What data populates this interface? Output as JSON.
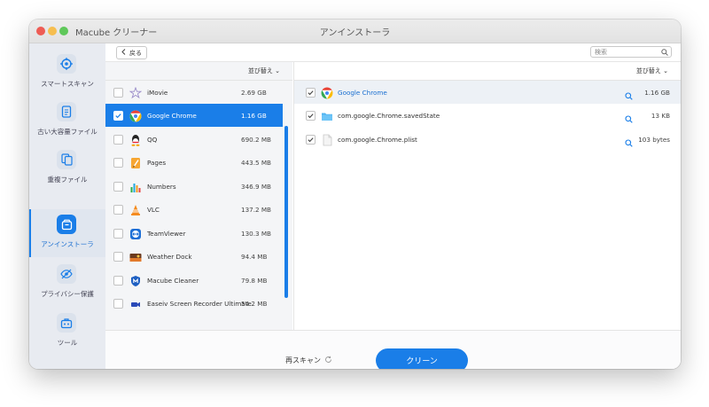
{
  "window": {
    "app_name": "Macube クリーナー",
    "title": "アンインストーラ"
  },
  "sidebar": {
    "items": [
      {
        "label": "スマートスキャン",
        "icon": "target-icon"
      },
      {
        "label": "古い大容量ファイル",
        "icon": "document-icon"
      },
      {
        "label": "重複ファイル",
        "icon": "duplicate-icon"
      },
      {
        "label": "アンインストーラ",
        "icon": "package-icon",
        "active": true
      },
      {
        "label": "プライバシー保護",
        "icon": "eye-off-icon"
      },
      {
        "label": "ツール",
        "icon": "toolbox-icon"
      }
    ]
  },
  "toolbar": {
    "back_label": "戻る",
    "search_placeholder": "検索"
  },
  "left_pane": {
    "sort_label": "並び替え",
    "apps": [
      {
        "name": "iMovie",
        "size": "2.69 GB"
      },
      {
        "name": "Google Chrome",
        "size": "1.16 GB",
        "selected": true
      },
      {
        "name": "QQ",
        "size": "690.2 MB"
      },
      {
        "name": "Pages",
        "size": "443.5 MB"
      },
      {
        "name": "Numbers",
        "size": "346.9 MB"
      },
      {
        "name": "VLC",
        "size": "137.2 MB"
      },
      {
        "name": "TeamViewer",
        "size": "130.3 MB"
      },
      {
        "name": "Weather Dock",
        "size": "94.4 MB"
      },
      {
        "name": "Macube Cleaner",
        "size": "79.8 MB"
      },
      {
        "name": "Easeiv Screen Recorder Ultimate",
        "size": "54.2 MB"
      }
    ]
  },
  "right_pane": {
    "sort_label": "並び替え",
    "files": [
      {
        "name": "Google Chrome",
        "size": "1.16 GB",
        "icon": "chrome-icon"
      },
      {
        "name": "com.google.Chrome.savedState",
        "size": "13 KB",
        "icon": "folder-icon"
      },
      {
        "name": "com.google.Chrome.plist",
        "size": "103 bytes",
        "icon": "file-icon"
      }
    ]
  },
  "footer": {
    "rescan_label": "再スキャン",
    "clean_label": "クリーン"
  },
  "colors": {
    "accent": "#1a7ee8",
    "sidebar_bg": "#e8ebf1"
  }
}
